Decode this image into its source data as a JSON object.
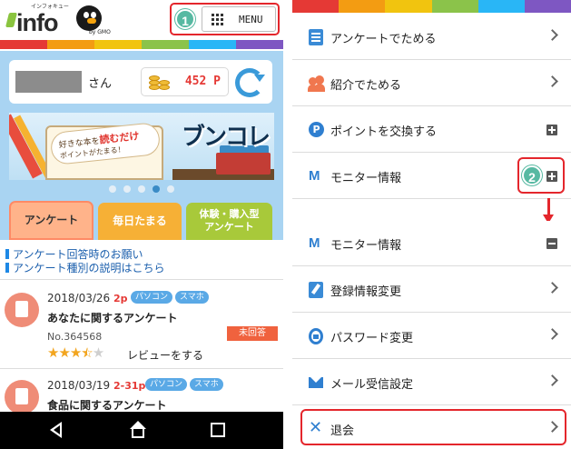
{
  "colors": {
    "accent_red": "#e4262c",
    "brand_blue": "#2f7fd0",
    "panel_blue": "#a9d4f2",
    "tab_orange": "#ffb38a",
    "tab_yellow": "#f6b036",
    "tab_green": "#a8c93a",
    "badge_teal": "#57b9a2",
    "stripe": [
      "#e53935",
      "#f39c12",
      "#f1c40f",
      "#8bc34a",
      "#29b6f6",
      "#7e57c2"
    ]
  },
  "left": {
    "logo": {
      "kana": "インフォキュー",
      "word": "info",
      "sub": "by GMO"
    },
    "menu_button": {
      "step": "1",
      "label": "MENU",
      "icon": "grid-icon"
    },
    "user": {
      "suffix": "さん",
      "points": "452 P",
      "coins_icon": "coins-icon",
      "refresh_icon": "refresh-icon"
    },
    "banner": {
      "line1_prefix": "好きな本を",
      "line1_emph": "読むだけ",
      "line2": "ポイントがたまる！",
      "brand": "ブンコレ"
    },
    "carousel": {
      "count": 5,
      "active": 4
    },
    "tabs": [
      {
        "label": "アンケート"
      },
      {
        "label": "毎日たまる"
      },
      {
        "label_line1": "体験・購入型",
        "label_line2": "アンケート"
      }
    ],
    "links": [
      "アンケート回答時のお願い",
      "アンケート種別の説明はこちら"
    ],
    "items": [
      {
        "date": "2018/03/26",
        "points": "2p",
        "tags": [
          "パソコン",
          "スマホ"
        ],
        "title": "あなたに関するアンケート",
        "number": "No.364568",
        "status": "未回答",
        "rating": 3.5,
        "review": "レビューをする"
      },
      {
        "date": "2018/03/19",
        "points": "2-31p",
        "tags": [
          "パソコン",
          "スマホ"
        ],
        "title": "食品に関するアンケート"
      }
    ],
    "navbar": {
      "back_icon": "back-icon",
      "home_icon": "home-icon",
      "recent_icon": "recent-apps-icon"
    }
  },
  "right": {
    "rows": [
      {
        "icon": "survey-icon",
        "label": "アンケートでためる",
        "control": "chevron"
      },
      {
        "icon": "referral-icon",
        "label": "紹介でためる",
        "control": "chevron"
      },
      {
        "icon": "point-exchange-icon",
        "label": "ポイントを交換する",
        "control": "plus"
      },
      {
        "icon": "monitor-icon",
        "label": "モニター情報",
        "control": "plus",
        "step": "2"
      },
      {
        "icon": "monitor-icon",
        "label": "モニター情報",
        "control": "minus"
      },
      {
        "icon": "edit-icon",
        "label": "登録情報変更",
        "control": "chevron"
      },
      {
        "icon": "lock-icon",
        "label": "パスワード変更",
        "control": "chevron"
      },
      {
        "icon": "mail-icon",
        "label": "メール受信設定",
        "control": "chevron"
      },
      {
        "icon": "close-icon",
        "label": "退会",
        "control": "chevron"
      }
    ]
  }
}
